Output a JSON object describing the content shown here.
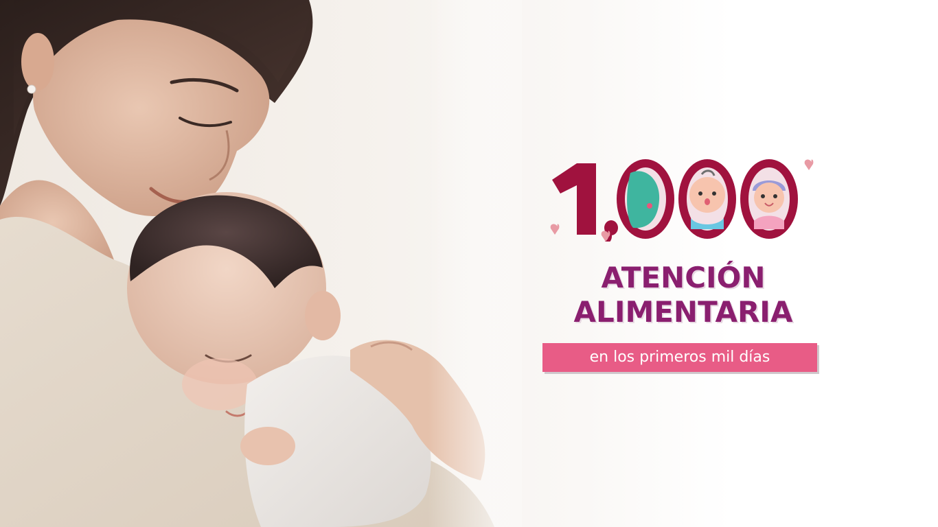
{
  "banner": {
    "numeral": "1,000",
    "title_line1": "ATENCIÓN",
    "title_line2": "ALIMENTARIA",
    "subtitle": "en los primeros mil días"
  },
  "colors": {
    "brand_crimson": "#a0123e",
    "brand_purple": "#8a1f6f",
    "ribbon_pink": "#e85c86",
    "heart_pink": "#e89aa4"
  },
  "photo": {
    "icon": "mother-holding-sleeping-baby"
  },
  "icons": [
    "pregnant-woman-icon",
    "baby-face-icon",
    "girl-face-icon",
    "heart-icon"
  ]
}
